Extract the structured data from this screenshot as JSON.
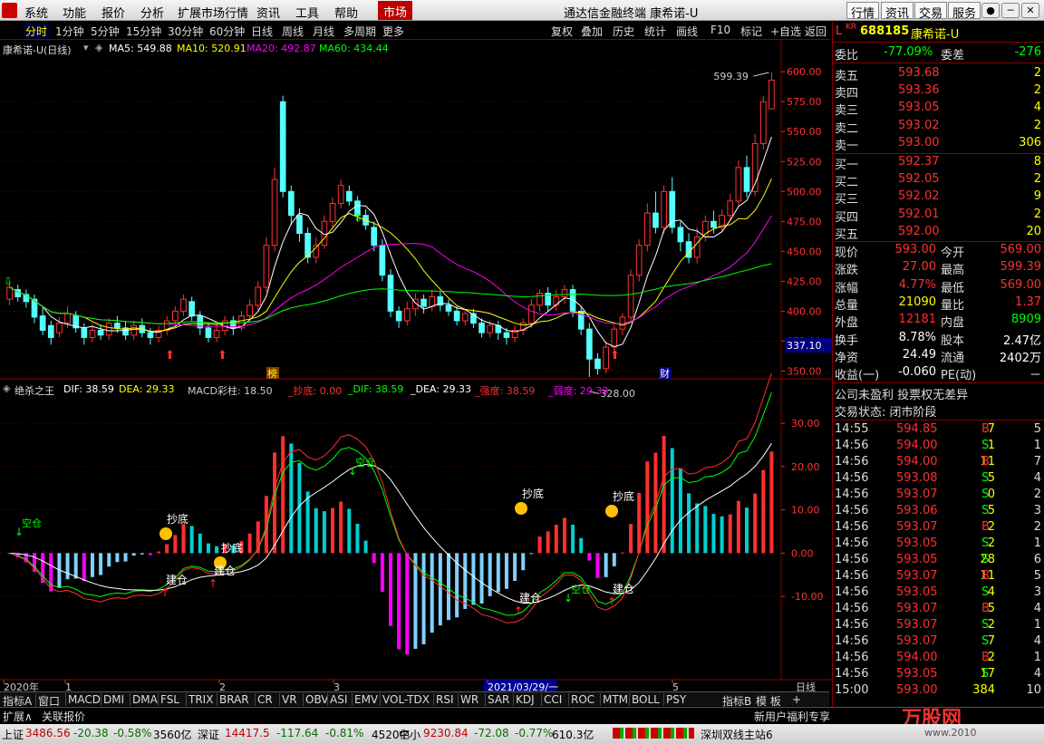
{
  "menubar": {
    "items": [
      "系统",
      "功能",
      "报价",
      "分析",
      "扩展市场行情",
      "资讯",
      "工具",
      "帮助"
    ],
    "market": "市场",
    "title": "通达信金融终端  康希诺-U",
    "right_buttons": [
      "行情",
      "资讯",
      "交易",
      "服务"
    ]
  },
  "toolbar": {
    "periods": [
      "分时",
      "1分钟",
      "5分钟",
      "15分钟",
      "30分钟",
      "60分钟",
      "日线",
      "周线",
      "月线",
      "多周期",
      "更多"
    ],
    "active_period": "分时",
    "right": [
      "复权",
      "叠加",
      "历史",
      "统计",
      "画线",
      "F10",
      "标记",
      "+自选",
      "返回"
    ]
  },
  "chart": {
    "title": "康希诺-U(日线)",
    "ma_labels": [
      {
        "text": "MA5: 549.88",
        "color": "#ffffff"
      },
      {
        "text": "MA10: 520.91",
        "color": "#ffff00"
      },
      {
        "text": "MA20: 492.87",
        "color": "#ff00ff"
      },
      {
        "text": "MA60: 434.44",
        "color": "#00ff00"
      }
    ],
    "price_axis": [
      "600.00",
      "575.00",
      "550.00",
      "525.00",
      "500.00",
      "475.00",
      "450.00",
      "425.00",
      "400.00",
      "375.00",
      "350.00"
    ],
    "current_price_tag": "337.10",
    "high_mark": "599.39",
    "low_mark": "328.00",
    "tag_bang": "榜",
    "tag_cai": "财"
  },
  "chart_data": {
    "type": "candlestick",
    "title": "康希诺-U(日线)",
    "ylim": [
      345,
      610
    ],
    "candles": [
      {
        "o": 410,
        "c": 420,
        "h": 425,
        "l": 405
      },
      {
        "o": 418,
        "c": 412,
        "h": 422,
        "l": 408
      },
      {
        "o": 414,
        "c": 408,
        "h": 418,
        "l": 403
      },
      {
        "o": 410,
        "c": 395,
        "h": 414,
        "l": 390
      },
      {
        "o": 396,
        "c": 384,
        "h": 404,
        "l": 380
      },
      {
        "o": 388,
        "c": 378,
        "h": 392,
        "l": 372
      },
      {
        "o": 382,
        "c": 390,
        "h": 395,
        "l": 378
      },
      {
        "o": 390,
        "c": 398,
        "h": 404,
        "l": 386
      },
      {
        "o": 396,
        "c": 386,
        "h": 400,
        "l": 382
      },
      {
        "o": 386,
        "c": 378,
        "h": 390,
        "l": 372
      },
      {
        "o": 378,
        "c": 384,
        "h": 390,
        "l": 374
      },
      {
        "o": 384,
        "c": 380,
        "h": 388,
        "l": 376
      },
      {
        "o": 380,
        "c": 390,
        "h": 394,
        "l": 376
      },
      {
        "o": 390,
        "c": 386,
        "h": 396,
        "l": 382
      },
      {
        "o": 386,
        "c": 380,
        "h": 392,
        "l": 376
      },
      {
        "o": 380,
        "c": 388,
        "h": 392,
        "l": 376
      },
      {
        "o": 388,
        "c": 382,
        "h": 394,
        "l": 378
      },
      {
        "o": 382,
        "c": 378,
        "h": 386,
        "l": 372
      },
      {
        "o": 378,
        "c": 384,
        "h": 388,
        "l": 374
      },
      {
        "o": 384,
        "c": 392,
        "h": 396,
        "l": 380
      },
      {
        "o": 392,
        "c": 400,
        "h": 404,
        "l": 388
      },
      {
        "o": 400,
        "c": 410,
        "h": 414,
        "l": 396
      },
      {
        "o": 408,
        "c": 396,
        "h": 412,
        "l": 392
      },
      {
        "o": 396,
        "c": 386,
        "h": 400,
        "l": 380
      },
      {
        "o": 386,
        "c": 378,
        "h": 390,
        "l": 374
      },
      {
        "o": 378,
        "c": 384,
        "h": 390,
        "l": 374
      },
      {
        "o": 384,
        "c": 392,
        "h": 396,
        "l": 380
      },
      {
        "o": 392,
        "c": 386,
        "h": 396,
        "l": 380
      },
      {
        "o": 386,
        "c": 396,
        "h": 400,
        "l": 384
      },
      {
        "o": 396,
        "c": 405,
        "h": 410,
        "l": 392
      },
      {
        "o": 405,
        "c": 420,
        "h": 425,
        "l": 400
      },
      {
        "o": 420,
        "c": 455,
        "h": 462,
        "l": 416
      },
      {
        "o": 455,
        "c": 510,
        "h": 520,
        "l": 450
      },
      {
        "o": 575,
        "c": 500,
        "h": 580,
        "l": 495
      },
      {
        "o": 500,
        "c": 480,
        "h": 505,
        "l": 472
      },
      {
        "o": 480,
        "c": 465,
        "h": 486,
        "l": 458
      },
      {
        "o": 465,
        "c": 445,
        "h": 470,
        "l": 440
      },
      {
        "o": 445,
        "c": 455,
        "h": 462,
        "l": 440
      },
      {
        "o": 455,
        "c": 475,
        "h": 480,
        "l": 452
      },
      {
        "o": 475,
        "c": 490,
        "h": 495,
        "l": 470
      },
      {
        "o": 490,
        "c": 505,
        "h": 510,
        "l": 486
      },
      {
        "o": 500,
        "c": 492,
        "h": 505,
        "l": 488
      },
      {
        "o": 492,
        "c": 480,
        "h": 496,
        "l": 475
      },
      {
        "o": 480,
        "c": 472,
        "h": 485,
        "l": 468
      },
      {
        "o": 470,
        "c": 455,
        "h": 475,
        "l": 450
      },
      {
        "o": 455,
        "c": 430,
        "h": 460,
        "l": 425
      },
      {
        "o": 430,
        "c": 400,
        "h": 435,
        "l": 395
      },
      {
        "o": 400,
        "c": 392,
        "h": 404,
        "l": 386
      },
      {
        "o": 392,
        "c": 402,
        "h": 408,
        "l": 388
      },
      {
        "o": 402,
        "c": 410,
        "h": 415,
        "l": 396
      },
      {
        "o": 410,
        "c": 404,
        "h": 414,
        "l": 398
      },
      {
        "o": 404,
        "c": 412,
        "h": 418,
        "l": 400
      },
      {
        "o": 412,
        "c": 405,
        "h": 416,
        "l": 400
      },
      {
        "o": 405,
        "c": 400,
        "h": 410,
        "l": 396
      },
      {
        "o": 400,
        "c": 392,
        "h": 404,
        "l": 388
      },
      {
        "o": 392,
        "c": 398,
        "h": 402,
        "l": 388
      },
      {
        "o": 398,
        "c": 390,
        "h": 402,
        "l": 386
      },
      {
        "o": 390,
        "c": 382,
        "h": 394,
        "l": 378
      },
      {
        "o": 382,
        "c": 388,
        "h": 392,
        "l": 378
      },
      {
        "o": 388,
        "c": 382,
        "h": 392,
        "l": 376
      },
      {
        "o": 382,
        "c": 378,
        "h": 386,
        "l": 372
      },
      {
        "o": 378,
        "c": 384,
        "h": 388,
        "l": 374
      },
      {
        "o": 384,
        "c": 390,
        "h": 394,
        "l": 380
      },
      {
        "o": 390,
        "c": 405,
        "h": 410,
        "l": 386
      },
      {
        "o": 405,
        "c": 415,
        "h": 418,
        "l": 400
      },
      {
        "o": 415,
        "c": 405,
        "h": 420,
        "l": 400
      },
      {
        "o": 405,
        "c": 412,
        "h": 418,
        "l": 400
      },
      {
        "o": 412,
        "c": 418,
        "h": 422,
        "l": 406
      },
      {
        "o": 418,
        "c": 400,
        "h": 422,
        "l": 395
      },
      {
        "o": 400,
        "c": 385,
        "h": 404,
        "l": 380
      },
      {
        "o": 385,
        "c": 360,
        "h": 390,
        "l": 345
      },
      {
        "o": 360,
        "c": 352,
        "h": 365,
        "l": 347
      },
      {
        "o": 352,
        "c": 370,
        "h": 375,
        "l": 348
      },
      {
        "o": 370,
        "c": 385,
        "h": 388,
        "l": 366
      },
      {
        "o": 385,
        "c": 395,
        "h": 398,
        "l": 380
      },
      {
        "o": 395,
        "c": 430,
        "h": 435,
        "l": 392
      },
      {
        "o": 430,
        "c": 455,
        "h": 460,
        "l": 425
      },
      {
        "o": 455,
        "c": 482,
        "h": 490,
        "l": 450
      },
      {
        "o": 482,
        "c": 470,
        "h": 500,
        "l": 465
      },
      {
        "o": 470,
        "c": 500,
        "h": 505,
        "l": 465
      },
      {
        "o": 500,
        "c": 470,
        "h": 512,
        "l": 465
      },
      {
        "o": 470,
        "c": 458,
        "h": 475,
        "l": 450
      },
      {
        "o": 458,
        "c": 445,
        "h": 465,
        "l": 440
      },
      {
        "o": 445,
        "c": 462,
        "h": 470,
        "l": 440
      },
      {
        "o": 462,
        "c": 475,
        "h": 480,
        "l": 458
      },
      {
        "o": 475,
        "c": 470,
        "h": 484,
        "l": 465
      },
      {
        "o": 470,
        "c": 480,
        "h": 485,
        "l": 466
      },
      {
        "o": 480,
        "c": 492,
        "h": 498,
        "l": 476
      },
      {
        "o": 492,
        "c": 520,
        "h": 526,
        "l": 488
      },
      {
        "o": 520,
        "c": 500,
        "h": 530,
        "l": 495
      },
      {
        "o": 500,
        "c": 540,
        "h": 548,
        "l": 496
      },
      {
        "o": 540,
        "c": 575,
        "h": 580,
        "l": 535
      },
      {
        "o": 569,
        "c": 593,
        "h": 599.39,
        "l": 569
      }
    ]
  },
  "indicator": {
    "name": "绝杀之王",
    "labels": [
      {
        "text": "DIF: 38.59",
        "color": "#ffffff"
      },
      {
        "text": "DEA: 29.33",
        "color": "#ffff00"
      },
      {
        "text": "MACD彩柱: 18.50",
        "color": "#cccccc"
      },
      {
        "text": "_抄底: 0.00",
        "color": "#ff3030"
      },
      {
        "text": "_DIF: 38.59",
        "color": "#00ff00"
      },
      {
        "text": "_DEA: 29.33",
        "color": "#ffffff"
      },
      {
        "text": "_强度: 38.59",
        "color": "#ff3030"
      },
      {
        "text": "_弱度: 29.33",
        "color": "#ff00ff"
      }
    ],
    "axis": [
      "30.00",
      "20.00",
      "10.00",
      "0.00",
      "-10.00"
    ],
    "signal_dip": "抄底",
    "signal_build": "建仓",
    "signal_empty": "空仓"
  },
  "date_axis": [
    "2020年",
    "1",
    "2",
    "3",
    "2021/03/29/一",
    "5",
    "日线"
  ],
  "quote": {
    "code": "688185",
    "name": "康希诺-U",
    "weibi_label": "委比",
    "weibi": "-77.09%",
    "weicha_label": "委差",
    "weicha": "-276",
    "asks": [
      {
        "label": "卖五",
        "price": "593.68",
        "vol": "2"
      },
      {
        "label": "卖四",
        "price": "593.36",
        "vol": "2"
      },
      {
        "label": "卖三",
        "price": "593.05",
        "vol": "4"
      },
      {
        "label": "卖二",
        "price": "593.02",
        "vol": "2"
      },
      {
        "label": "卖一",
        "price": "593.00",
        "vol": "306"
      }
    ],
    "bids": [
      {
        "label": "买一",
        "price": "592.37",
        "vol": "8"
      },
      {
        "label": "买二",
        "price": "592.05",
        "vol": "2"
      },
      {
        "label": "买三",
        "price": "592.02",
        "vol": "9"
      },
      {
        "label": "买四",
        "price": "592.01",
        "vol": "2"
      },
      {
        "label": "买五",
        "price": "592.00",
        "vol": "20"
      }
    ],
    "stats": [
      {
        "l1": "现价",
        "v1": "593.00",
        "l2": "今开",
        "v2": "569.00",
        "c1": "#ff3030",
        "c2": "#ff3030"
      },
      {
        "l1": "涨跌",
        "v1": "27.00",
        "l2": "最高",
        "v2": "599.39",
        "c1": "#ff3030",
        "c2": "#ff3030"
      },
      {
        "l1": "涨幅",
        "v1": "4.77%",
        "l2": "最低",
        "v2": "569.00",
        "c1": "#ff3030",
        "c2": "#ff3030"
      },
      {
        "l1": "总量",
        "v1": "21090",
        "l2": "量比",
        "v2": "1.37",
        "c1": "#ffff00",
        "c2": "#ff3030"
      },
      {
        "l1": "外盘",
        "v1": "12181",
        "l2": "内盘",
        "v2": "8909",
        "c1": "#ff3030",
        "c2": "#00ff00"
      },
      {
        "l1": "换手",
        "v1": "8.78%",
        "l2": "股本",
        "v2": "2.47亿",
        "c1": "#ffffff",
        "c2": "#ffffff"
      },
      {
        "l1": "净资",
        "v1": "24.49",
        "l2": "流通",
        "v2": "2402万",
        "c1": "#ffffff",
        "c2": "#ffffff"
      },
      {
        "l1": "收益(一)",
        "v1": "-0.060",
        "l2": "PE(动)",
        "v2": "－",
        "c1": "#ffffff",
        "c2": "#ffffff"
      }
    ],
    "notice1": "公司未盈利 投票权无差异",
    "notice2": "交易状态: 闭市阶段",
    "ticks": [
      {
        "t": "14:55",
        "p": "594.85",
        "v": "7",
        "s": "B",
        "n": "5"
      },
      {
        "t": "14:56",
        "p": "594.00",
        "v": "1",
        "s": "S",
        "n": "1"
      },
      {
        "t": "14:56",
        "p": "594.00",
        "v": "11",
        "s": "B",
        "n": "7"
      },
      {
        "t": "14:56",
        "p": "593.08",
        "v": "5",
        "s": "S",
        "n": "4"
      },
      {
        "t": "14:56",
        "p": "593.07",
        "v": "0",
        "s": "S",
        "n": "2"
      },
      {
        "t": "14:56",
        "p": "593.06",
        "v": "5",
        "s": "S",
        "n": "3"
      },
      {
        "t": "14:56",
        "p": "593.07",
        "v": "2",
        "s": "B",
        "n": "2"
      },
      {
        "t": "14:56",
        "p": "593.05",
        "v": "2",
        "s": "S",
        "n": "1"
      },
      {
        "t": "14:56",
        "p": "593.05",
        "v": "28",
        "s": "S",
        "n": "6"
      },
      {
        "t": "14:56",
        "p": "593.07",
        "v": "11",
        "s": "B",
        "n": "5"
      },
      {
        "t": "14:56",
        "p": "593.05",
        "v": "4",
        "s": "S",
        "n": "3"
      },
      {
        "t": "14:56",
        "p": "593.07",
        "v": "5",
        "s": "B",
        "n": "4"
      },
      {
        "t": "14:56",
        "p": "593.07",
        "v": "2",
        "s": "S",
        "n": "1"
      },
      {
        "t": "14:56",
        "p": "593.07",
        "v": "7",
        "s": "S",
        "n": "4"
      },
      {
        "t": "14:56",
        "p": "594.00",
        "v": "2",
        "s": "B",
        "n": "1"
      },
      {
        "t": "14:56",
        "p": "593.05",
        "v": "17",
        "s": "S",
        "n": "4"
      },
      {
        "t": "15:00",
        "p": "593.00",
        "v": "384",
        "s": "",
        "n": "10"
      }
    ]
  },
  "tabs": [
    "指标A",
    "窗口",
    "MACD",
    "DMI",
    "DMA",
    "FSL",
    "TRIX",
    "BRAR",
    "CR",
    "VR",
    "OBV",
    "ASI",
    "EMV",
    "VOL-TDX",
    "RSI",
    "WR",
    "SAR",
    "KDJ",
    "CCI",
    "ROC",
    "MTM",
    "BOLL",
    "PSY",
    "指标B",
    "模 板",
    "+"
  ],
  "subbar": {
    "left": [
      "扩展∧",
      "关联报价"
    ],
    "right": [
      "新用户福利专享"
    ]
  },
  "status": [
    {
      "text": "上证",
      "color": "#000000"
    },
    {
      "text": "3486.56",
      "color": "#c00000"
    },
    {
      "text": "-20.38",
      "color": "#007000"
    },
    {
      "text": "-0.58%",
      "color": "#007000"
    },
    {
      "text": "3560亿",
      "color": "#000000"
    },
    {
      "text": "深证",
      "color": "#000000"
    },
    {
      "text": "14417.5",
      "color": "#c00000"
    },
    {
      "text": "-117.64",
      "color": "#007000"
    },
    {
      "text": "-0.81%",
      "color": "#007000"
    },
    {
      "text": "4520亿",
      "color": "#000000"
    },
    {
      "text": "中小",
      "color": "#000000"
    },
    {
      "text": "9230.84",
      "color": "#c00000"
    },
    {
      "text": "-72.08",
      "color": "#007000"
    },
    {
      "text": "-0.77%",
      "color": "#007000"
    },
    {
      "text": "610.3亿",
      "color": "#000000"
    },
    {
      "text": "深圳双线主站6",
      "color": "#000000"
    }
  ],
  "watermark": {
    "brand": "万股网",
    "url": "www.2010"
  }
}
